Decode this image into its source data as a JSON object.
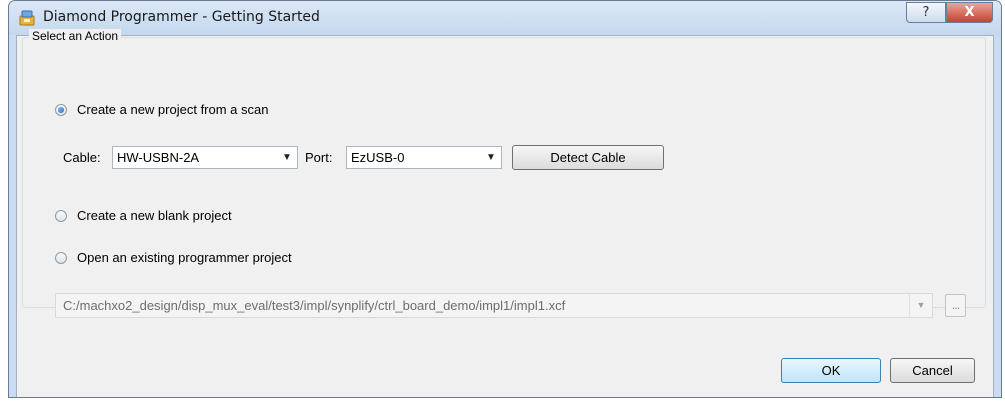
{
  "window": {
    "title": "Diamond Programmer - Getting Started",
    "help_symbol": "?",
    "close_symbol": "X"
  },
  "group": {
    "label": "Select an Action"
  },
  "options": {
    "scan_label": "Create a new project from a scan",
    "blank_label": "Create a new blank project",
    "existing_label": "Open an existing programmer project",
    "selected": "scan"
  },
  "cable": {
    "label": "Cable:",
    "value": "HW-USBN-2A",
    "port_label": "Port:",
    "port_value": "EzUSB-0",
    "detect_label": "Detect Cable"
  },
  "project_path": {
    "value": "C:/machxo2_design/disp_mux_eval/test3/impl/synplify/ctrl_board_demo/impl1/impl1.xcf",
    "browse_label": "..."
  },
  "buttons": {
    "ok": "OK",
    "cancel": "Cancel"
  },
  "icons": {
    "app": "diamond-programmer-icon",
    "dropdown": "chevron-down-icon",
    "help": "help-icon",
    "close": "close-icon"
  }
}
